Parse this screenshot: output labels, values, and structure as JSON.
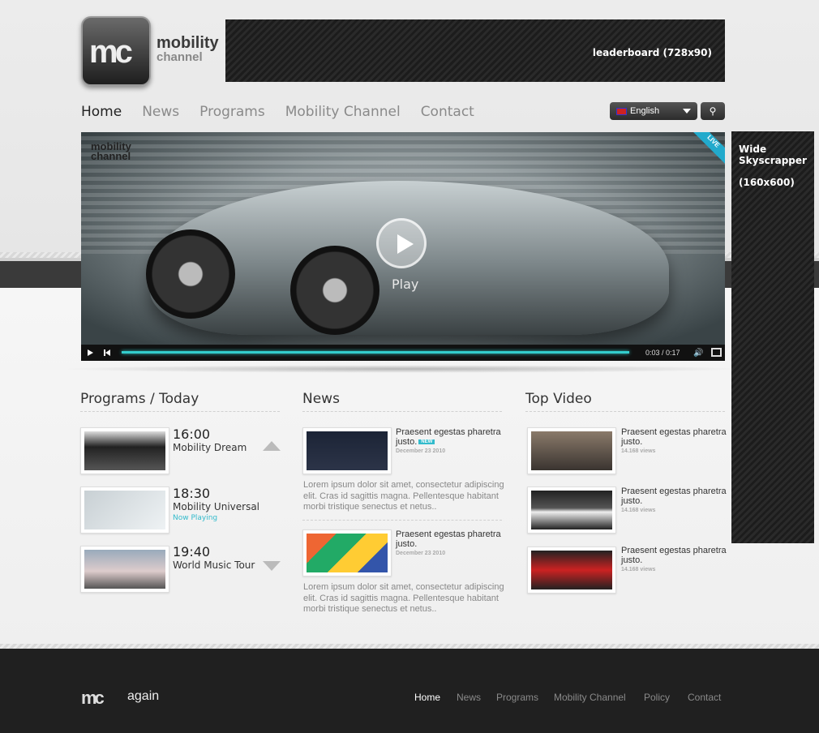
{
  "brand": {
    "logo_mark": "mc",
    "name_line1": "mobility",
    "name_line2": "channel"
  },
  "leaderboard": {
    "label": "leaderboard  (728x90)"
  },
  "nav": {
    "items": [
      {
        "label": "Home",
        "active": true
      },
      {
        "label": "News"
      },
      {
        "label": "Programs"
      },
      {
        "label": "Mobility Channel"
      },
      {
        "label": "Contact"
      }
    ]
  },
  "language": {
    "selected": "English"
  },
  "player": {
    "logo_line1": "mobility",
    "logo_line2": "channel",
    "live_badge": "LIVE",
    "play_label": "Play",
    "time": "0:03 / 0:17",
    "progress": 0.99
  },
  "skyscraper": {
    "line1": "Wide",
    "line2": "Skyscrapper",
    "line3": "(160x600)"
  },
  "programs": {
    "title": "Programs / Today",
    "items": [
      {
        "time": "16:00",
        "name": "Mobility Dream",
        "status": ""
      },
      {
        "time": "18:30",
        "name": "Mobility Universal",
        "status": "Now Playing"
      },
      {
        "time": "19:40",
        "name": "World Music Tour",
        "status": ""
      }
    ]
  },
  "news": {
    "title": "News",
    "items": [
      {
        "title": "Praesent egestas pharetra justo.",
        "badge": "NEW",
        "date": "December 23 2010",
        "body": "Lorem ipsum dolor sit amet, consectetur adipiscing elit. Cras id sagittis magna. Pellentesque habitant morbi tristique senectus et netus.."
      },
      {
        "title": "Praesent egestas pharetra justo.",
        "date": "December 23 2010",
        "body": "Lorem ipsum dolor sit amet, consectetur adipiscing elit. Cras id sagittis magna. Pellentesque habitant morbi tristique senectus et netus.."
      }
    ]
  },
  "top_video": {
    "title": "Top Video",
    "items": [
      {
        "title": "Praesent egestas pharetra justo.",
        "views": "14.168 views"
      },
      {
        "title": "Praesent egestas pharetra justo.",
        "views": "14.168 views"
      },
      {
        "title": "Praesent egestas pharetra justo.",
        "views": "14.168 views"
      }
    ]
  },
  "footer": {
    "logo_mark": "mc",
    "partner": "again",
    "nav": [
      "Home",
      "News",
      "Programs",
      "Mobility Channel",
      "Policy",
      "Contact"
    ]
  }
}
